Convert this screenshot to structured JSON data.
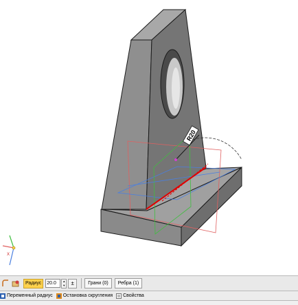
{
  "viewport": {
    "dimension_label": "R20",
    "axis_label": "X",
    "colors": {
      "part_front": "#8d8d8d",
      "part_side": "#6c6c6c",
      "part_top": "#9a9a9a",
      "edge": "#1a1a1a",
      "plane_red": "#e06060",
      "plane_blue": "#4a7fe0",
      "plane_green": "#3fbf3f",
      "selected_edge": "#e00000"
    }
  },
  "toolbar": {
    "icons": [
      "fillet-icon",
      "preview-icon"
    ],
    "radius_label": "Радиус",
    "radius_value": "20.0",
    "pm_symbol": "±",
    "faces_button": "Грани (0)",
    "edges_button": "Ребра (1)"
  },
  "tabs": [
    {
      "label": "Переменный радиус",
      "icon": "variable-radius-icon"
    },
    {
      "label": "Остановка скругления",
      "icon": "fillet-stop-icon"
    },
    {
      "label": "Свойства",
      "icon": "properties-icon"
    }
  ]
}
